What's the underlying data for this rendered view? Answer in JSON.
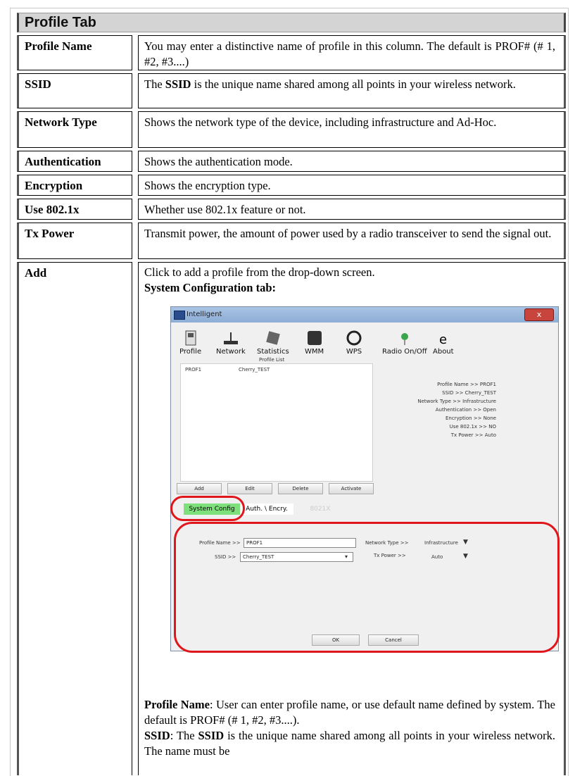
{
  "title": "Profile Tab",
  "rows": [
    {
      "label": "Profile Name",
      "desc": "You may enter a distinctive name of profile in this column. The default is PROF# (# 1, #2, #3....)"
    },
    {
      "label": "SSID",
      "desc_pre": "The ",
      "desc_bold": "SSID",
      "desc_post": " is the unique name shared among all points in your wireless network."
    },
    {
      "label": "Network Type",
      "desc": "Shows the network type of the device, including infrastructure and Ad-Hoc."
    },
    {
      "label": "Authentication",
      "desc": "Shows the authentication mode."
    },
    {
      "label": "Encryption",
      "desc": "Shows the encryption type."
    },
    {
      "label": "Use 802.1x",
      "desc": "Whether use 802.1x feature or not."
    },
    {
      "label": "Tx Power",
      "desc": "Transmit power, the amount of power used by a radio transceiver to send the signal out."
    },
    {
      "label": "Add",
      "desc_line1": "Click to add a profile from the drop-down screen.",
      "desc_heading": "System Configuration tab:",
      "pn_bold": "Profile Name",
      "pn_text": ": User can enter profile name, or use default name defined by system. The default is PROF# (# 1, #2, #3....).",
      "ssid_bold": "SSID",
      "ssid_mid": ": The ",
      "ssid_bold2": "SSID",
      "ssid_text": " is the unique name shared among all points in your wireless network. The name must be"
    }
  ],
  "window": {
    "title": "Intelligent",
    "close": "x",
    "toolbar": [
      "Profile",
      "Network",
      "Statistics",
      "WMM",
      "WPS",
      "Radio On/Off",
      "About"
    ],
    "profile_list_title": "Profile List",
    "profile_row": {
      "name": "PROF1",
      "ssid": "Cherry_TEST"
    },
    "info": [
      "Profile Name >> PROF1",
      "SSID >> Cherry_TEST",
      "Network Type >> Infrastructure",
      "Authentication >> Open",
      "Encryption >> None",
      "Use 802.1x >> NO",
      "Tx Power >> Auto"
    ],
    "buttons": [
      "Add",
      "Edit",
      "Delete",
      "Activate"
    ],
    "tabs": [
      "System Config",
      "Auth. \\ Encry.",
      "8021X"
    ],
    "form": {
      "profile_name_label": "Profile Name >>",
      "profile_name_value": "PROF1",
      "ssid_label": "SSID >>",
      "ssid_value": "Cherry_TEST",
      "network_type_label": "Network Type >>",
      "network_type_value": "Infrastructure",
      "tx_power_label": "Tx Power >>",
      "tx_power_value": "Auto"
    },
    "ok": "OK",
    "cancel": "Cancel"
  },
  "colors": {
    "highlight": "#e0161d",
    "tab_active": "#7ee07a"
  }
}
